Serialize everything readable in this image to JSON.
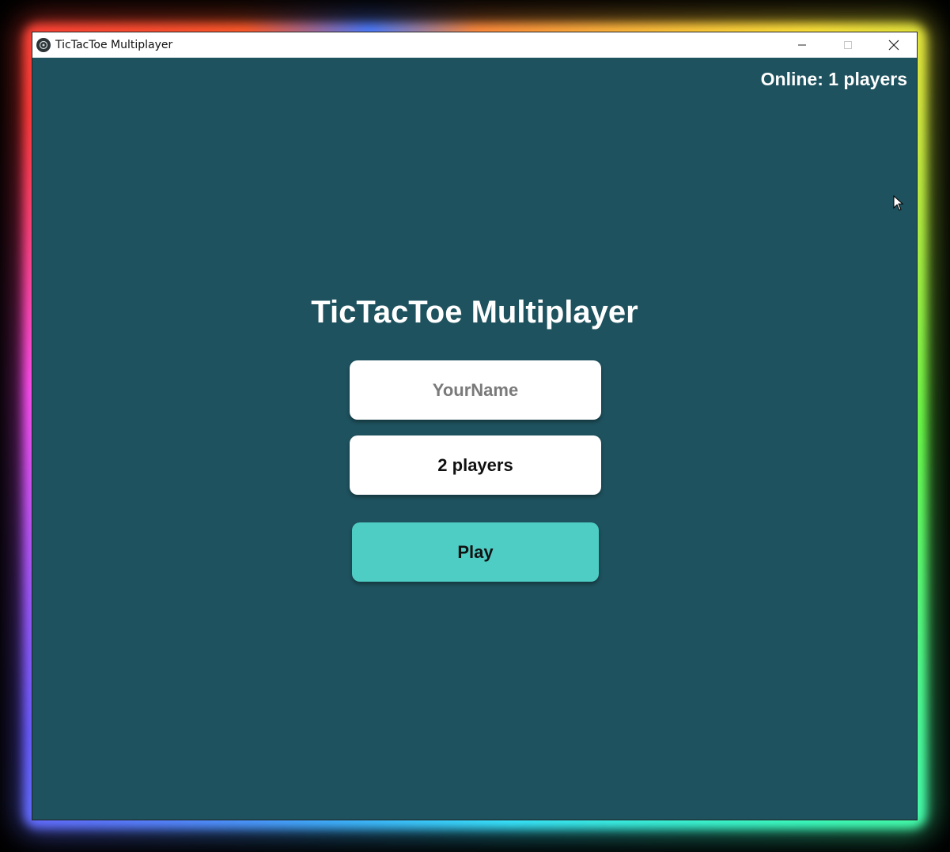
{
  "window": {
    "title": "TicTacToe Multiplayer",
    "controls": {
      "minimize": "minimize-icon",
      "maximize": "maximize-icon",
      "close": "close-icon"
    }
  },
  "status": {
    "online_text": "Online: 1 players"
  },
  "lobby": {
    "heading": "TicTacToe Multiplayer",
    "name_input": {
      "value": "",
      "placeholder": "YourName"
    },
    "players_select": {
      "selected": "2 players"
    },
    "play_label": "Play"
  },
  "colors": {
    "background": "#1e525e",
    "play_button": "#4ecdc4",
    "field": "#ffffff",
    "text_light": "#ffffff"
  }
}
